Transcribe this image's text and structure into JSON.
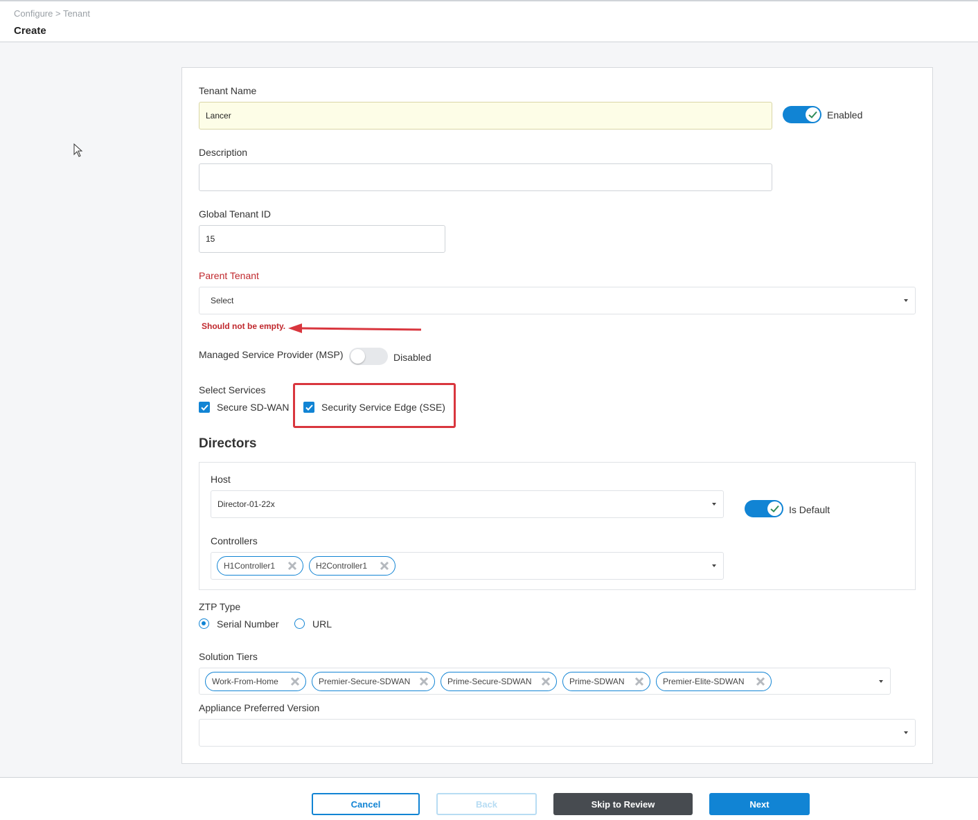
{
  "header": {
    "breadcrumb": "Configure > Tenant",
    "title": "Create"
  },
  "form": {
    "tenant_name": {
      "label": "Tenant Name",
      "value": "Lancer"
    },
    "enabled": {
      "label": "Enabled",
      "on": true
    },
    "description": {
      "label": "Description",
      "value": ""
    },
    "global_tenant_id": {
      "label": "Global Tenant ID",
      "value": "15"
    },
    "parent_tenant": {
      "label": "Parent Tenant",
      "value": "Select",
      "error": "Should not be empty."
    },
    "msp": {
      "label": "Managed Service Provider (MSP)",
      "state": "Disabled",
      "on": false
    },
    "services": {
      "label": "Select Services",
      "items": [
        {
          "label": "Secure SD-WAN",
          "checked": true
        },
        {
          "label": "Security Service Edge (SSE)",
          "checked": true
        }
      ]
    },
    "directors": {
      "title": "Directors",
      "host_label": "Host",
      "host_value": "Director-01-22x",
      "is_default_label": "Is Default",
      "is_default_on": true,
      "controllers_label": "Controllers",
      "controllers": [
        "H1Controller1",
        "H2Controller1"
      ]
    },
    "ztp": {
      "label": "ZTP Type",
      "options": [
        {
          "label": "Serial Number",
          "selected": true
        },
        {
          "label": "URL",
          "selected": false
        }
      ]
    },
    "solution_tiers": {
      "label": "Solution Tiers",
      "items": [
        "Work-From-Home",
        "Premier-Secure-SDWAN",
        "Prime-Secure-SDWAN",
        "Prime-SDWAN",
        "Premier-Elite-SDWAN"
      ]
    },
    "appliance_version": {
      "label": "Appliance Preferred Version",
      "value": ""
    }
  },
  "footer": {
    "cancel": "Cancel",
    "back": "Back",
    "skip": "Skip to Review",
    "next": "Next"
  },
  "colors": {
    "accent": "#1184d4",
    "error": "#c0282d",
    "dark_button": "#474b50"
  }
}
